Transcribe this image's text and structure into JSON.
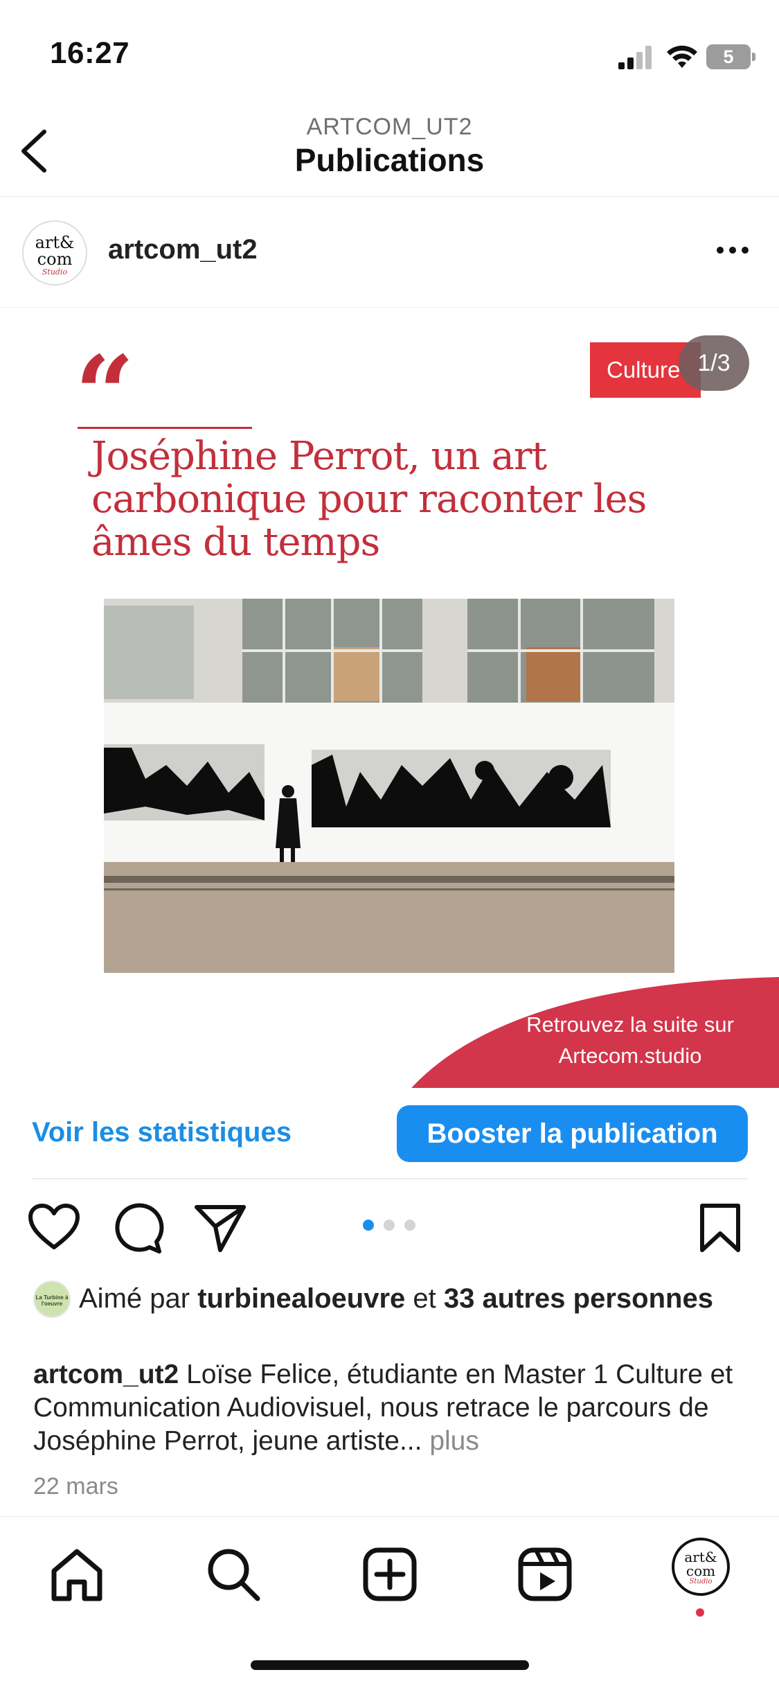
{
  "status_bar": {
    "time": "16:27",
    "battery_level": "5"
  },
  "header": {
    "account": "ARTCOM_UT2",
    "title": "Publications"
  },
  "post": {
    "username": "artcom_ut2",
    "avatar_logo": [
      "art&",
      "com",
      "Studio"
    ],
    "image": {
      "category_tag": "Culture",
      "slide_counter": "1/3",
      "quote_mark": "“",
      "headline": "Joséphine Perrot, un art carbonique pour raconter les âmes du temps",
      "cta_line1": "Retrouvez la suite sur",
      "cta_line2": "Artecom.studio",
      "brand_color": "#c22f3b",
      "tag_color": "#e4343d"
    },
    "stats_link": "Voir les statistiques",
    "boost_button": "Booster la publication",
    "carousel": {
      "total": 3,
      "active": 0
    },
    "likes": {
      "prefix": "Aimé par",
      "user": "turbinealoeuvre",
      "middle": "et",
      "others": "33 autres personnes",
      "liker_avatar_text": "La Turbine à l'oeuvre"
    },
    "caption": {
      "user": "artcom_ut2",
      "text": "Loïse Felice, étudiante en Master 1 Culture et Communication Audiovisuel, nous retrace le parcours de Joséphine Perrot, jeune artiste...",
      "more": "plus"
    },
    "date": "22 mars"
  },
  "icons": {
    "back": "chevron-left-icon",
    "more": "ellipsis-icon",
    "like": "heart-icon",
    "comment": "comment-icon",
    "share": "paper-plane-icon",
    "save": "bookmark-icon"
  },
  "tab_bar": {
    "items": [
      "home-icon",
      "search-icon",
      "create-icon",
      "reels-icon",
      "profile-avatar"
    ],
    "accent": "#1a8ef0"
  }
}
